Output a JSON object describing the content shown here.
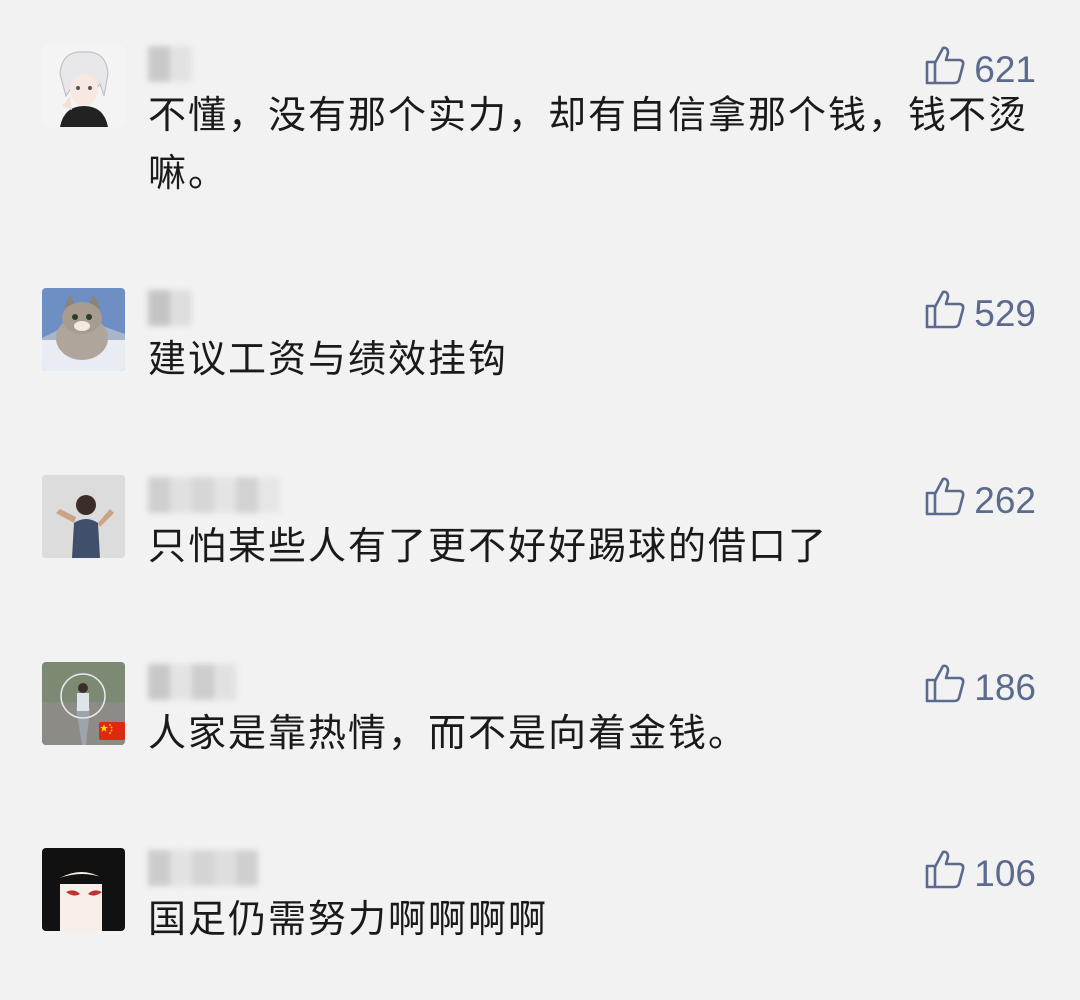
{
  "comments": [
    {
      "likes": "621",
      "text": "不懂，没有那个实力，却有自信拿那个钱，钱不烫嘛。"
    },
    {
      "likes": "529",
      "text": "建议工资与绩效挂钩"
    },
    {
      "likes": "262",
      "text": "只怕某些人有了更不好好踢球的借口了"
    },
    {
      "likes": "186",
      "text": "人家是靠热情，而不是向着金钱。"
    },
    {
      "likes": "106",
      "text": "国足仍需努力啊啊啊啊"
    }
  ],
  "colors": {
    "background": "#f2f2f2",
    "like_accent": "#5b6a8d",
    "text": "#1a1a1a"
  },
  "icons": {
    "like": "thumbs-up-icon",
    "flag": "china-flag-icon"
  }
}
